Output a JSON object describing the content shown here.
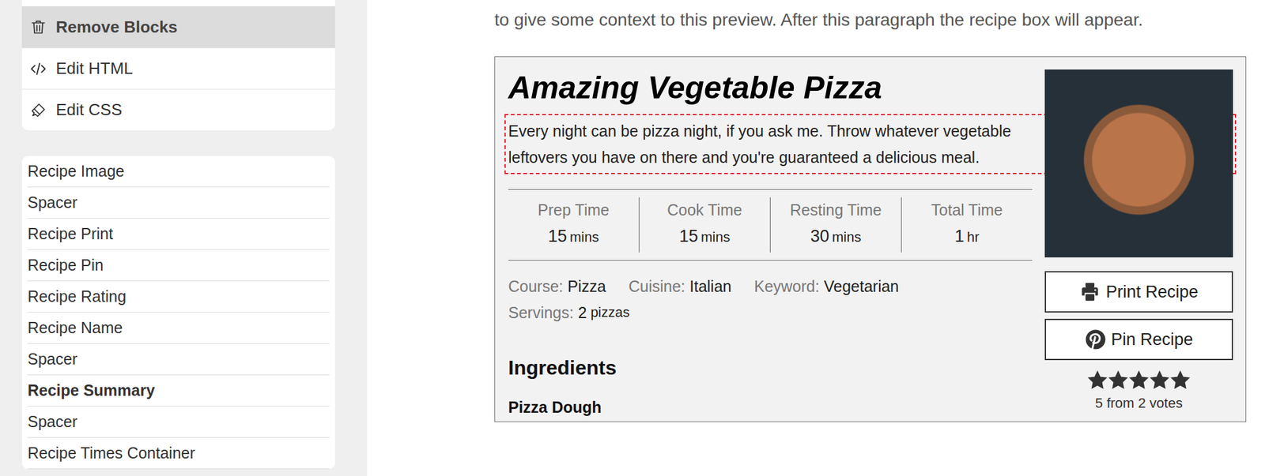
{
  "sidebar": {
    "actions": [
      {
        "label": "Remove Blocks",
        "selected": true
      },
      {
        "label": "Edit HTML",
        "selected": false
      },
      {
        "label": "Edit CSS",
        "selected": false
      }
    ],
    "blocks": [
      {
        "label": "Recipe Image",
        "selected": false
      },
      {
        "label": "Spacer",
        "selected": false
      },
      {
        "label": "Recipe Print",
        "selected": false
      },
      {
        "label": "Recipe Pin",
        "selected": false
      },
      {
        "label": "Recipe Rating",
        "selected": false
      },
      {
        "label": "Recipe Name",
        "selected": false
      },
      {
        "label": "Spacer",
        "selected": false
      },
      {
        "label": "Recipe Summary",
        "selected": true
      },
      {
        "label": "Spacer",
        "selected": false
      },
      {
        "label": "Recipe Times Container",
        "selected": false
      }
    ]
  },
  "preview": {
    "intro": "to give some context to this preview. After this paragraph the recipe box will appear.",
    "recipe": {
      "name": "Amazing Vegetable Pizza",
      "summary": "Every night can be pizza night, if you ask me. Throw whatever vegetable leftovers you have on there and you're guaranteed a delicious meal.",
      "summary_highlighted": true,
      "times": [
        {
          "label": "Prep Time",
          "value": "15",
          "unit": "mins"
        },
        {
          "label": "Cook Time",
          "value": "15",
          "unit": "mins"
        },
        {
          "label": "Resting Time",
          "value": "30",
          "unit": "mins"
        },
        {
          "label": "Total Time",
          "value": "1",
          "unit": "hr"
        }
      ],
      "meta": [
        {
          "label": "Course:",
          "value": "Pizza"
        },
        {
          "label": "Cuisine:",
          "value": "Italian"
        },
        {
          "label": "Keyword:",
          "value": "Vegetarian"
        }
      ],
      "servings": {
        "label": "Servings:",
        "value": "2",
        "unit": "pizzas"
      },
      "ingredients_heading": "Ingredients",
      "ingredient_group": "Pizza Dough",
      "buttons": [
        "Print Recipe",
        "Pin Recipe"
      ],
      "rating": {
        "stars": 5,
        "text": "5 from 2 votes"
      }
    }
  }
}
